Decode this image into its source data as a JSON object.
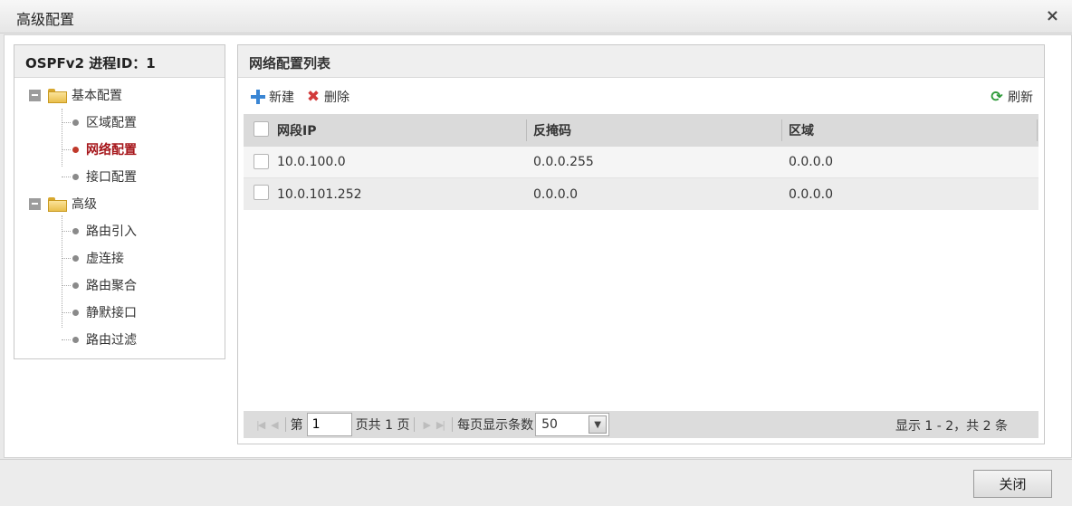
{
  "dialog": {
    "title": "高级配置",
    "close_glyph": "×",
    "close_button_label": "关闭"
  },
  "tree": {
    "title": "OSPFv2 进程ID：1",
    "groups": [
      {
        "label": "基本配置",
        "items": [
          {
            "label": "区域配置"
          },
          {
            "label": "网络配置",
            "selected": true
          },
          {
            "label": "接口配置"
          }
        ]
      },
      {
        "label": "高级",
        "items": [
          {
            "label": "路由引入"
          },
          {
            "label": "虚连接"
          },
          {
            "label": "路由聚合"
          },
          {
            "label": "静默接口"
          },
          {
            "label": "路由过滤"
          }
        ]
      }
    ]
  },
  "grid": {
    "title": "网络配置列表",
    "toolbar": {
      "new_label": "新建",
      "delete_label": "删除",
      "refresh_label": "刷新"
    },
    "columns": [
      "网段IP",
      "反掩码",
      "区域"
    ],
    "rows": [
      [
        "10.0.100.0",
        "0.0.0.255",
        "0.0.0.0"
      ],
      [
        "10.0.101.252",
        "0.0.0.0",
        "0.0.0.0"
      ]
    ]
  },
  "pager": {
    "page_prefix": "第",
    "page_value": "1",
    "page_suffix": "页共 1 页",
    "page_size_label": "每页显示条数",
    "page_size_value": "50",
    "summary": "显示 1 - 2，共 2 条"
  },
  "icons": {
    "new": "plus-icon",
    "delete": "delete-x-icon",
    "refresh": "refresh-icon",
    "folder": "folder-icon",
    "collapse": "collapse-minus-icon"
  },
  "colors": {
    "selected_text": "#a6161b",
    "add_icon": "#3a86d4",
    "delete_icon": "#d23a3a",
    "refresh_icon": "#2e9a3a"
  }
}
